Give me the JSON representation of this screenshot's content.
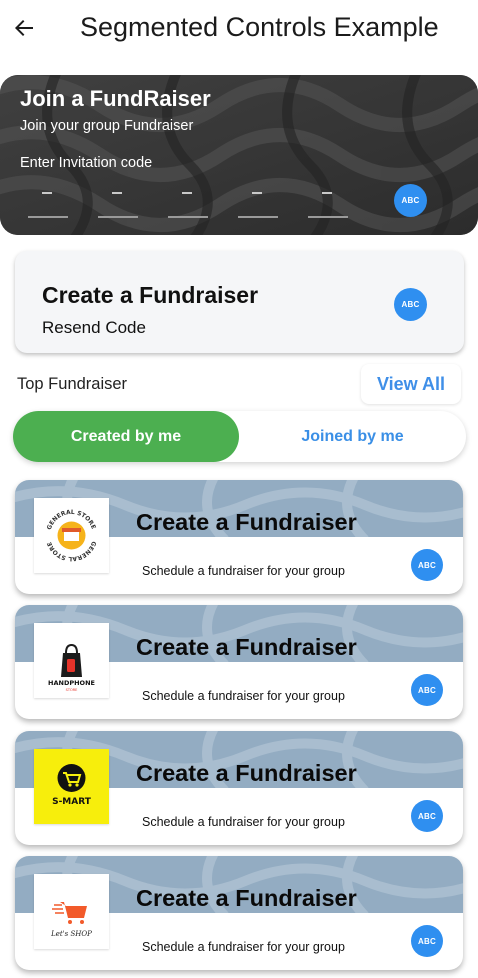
{
  "app": {
    "title": "Segmented Controls Example",
    "back_icon": "arrow-left-icon"
  },
  "hero": {
    "title": "Join a FundRaiser",
    "subtitle": "Join your group Fundraiser",
    "prompt": "Enter Invitation code",
    "code_slots": [
      "-",
      "-",
      "-",
      "-",
      "-"
    ],
    "badge": "ABC"
  },
  "create_card": {
    "title": "Create a Fundraiser",
    "subtitle": "Resend Code",
    "badge": "ABC"
  },
  "section": {
    "label": "Top Fundraiser",
    "view_all": "View All"
  },
  "segmented": {
    "selected": "Created by me",
    "other": "Joined by me",
    "selected_color": "#4caf50",
    "accent": "#3a8fe6"
  },
  "fundraisers": [
    {
      "title": "Create a Fundraiser",
      "subtitle": "Schedule a fundraiser for your group",
      "badge": "ABC",
      "logo": "general-store-logo",
      "logo_text": [
        "GENERAL STORE",
        "GENERAL STORE"
      ]
    },
    {
      "title": "Create a Fundraiser",
      "subtitle": "Schedule a fundraiser for your group",
      "badge": "ABC",
      "logo": "handphone-store-logo",
      "logo_text": [
        "HANDPHONE",
        "STORE"
      ]
    },
    {
      "title": "Create a Fundraiser",
      "subtitle": "Schedule a fundraiser for your group",
      "badge": "ABC",
      "logo": "s-mart-logo",
      "logo_text": [
        "S-MART"
      ]
    },
    {
      "title": "Create a Fundraiser",
      "subtitle": "Schedule a fundraiser for your group",
      "badge": "ABC",
      "logo": "lets-shop-logo",
      "logo_text": [
        "Let's SHOP"
      ]
    }
  ]
}
